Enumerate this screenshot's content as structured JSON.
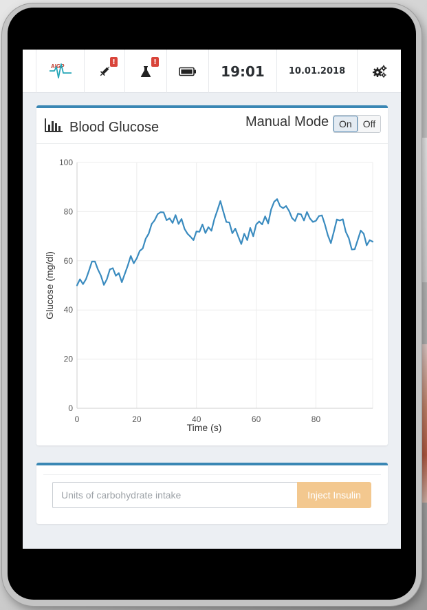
{
  "header": {
    "logo_text": "AIGP",
    "syringe_alert": "!",
    "lab_alert": "!",
    "time": "19:01",
    "date": "10.01.2018",
    "icons": [
      "aigp-logo-icon",
      "syringe-icon",
      "flask-icon",
      "battery-icon",
      "gears-icon"
    ],
    "alert_color": "#d9443a"
  },
  "chart_panel": {
    "title": "Blood Glucose",
    "mode_label": "Manual Mode",
    "toggle_on": "On",
    "toggle_off": "Off",
    "toggle_selected": "On",
    "accent_color": "#3a87b4"
  },
  "chart_data": {
    "type": "line",
    "title": "",
    "xlabel": "Time (s)",
    "ylabel": "Glucose (mg/dl)",
    "xlim": [
      0,
      99
    ],
    "ylim": [
      0,
      100
    ],
    "xticks": [
      "0",
      "20",
      "40",
      "60",
      "80"
    ],
    "yticks": [
      "0",
      "20",
      "40",
      "60",
      "80",
      "100"
    ],
    "grid": true,
    "line_color": "#3a8bbf",
    "series": [
      {
        "name": "",
        "x": [
          0,
          1,
          2,
          3,
          4,
          5,
          6,
          7,
          8,
          9,
          10,
          11,
          12,
          13,
          14,
          15,
          16,
          17,
          18,
          19,
          20,
          21,
          22,
          23,
          24,
          25,
          26,
          27,
          28,
          29,
          30,
          31,
          32,
          33,
          34,
          35,
          36,
          37,
          38,
          39,
          40,
          41,
          42,
          43,
          44,
          45,
          46,
          47,
          48,
          49,
          50,
          51,
          52,
          53,
          54,
          55,
          56,
          57,
          58,
          59,
          60,
          61,
          62,
          63,
          64,
          65,
          66,
          67,
          68,
          69,
          70,
          71,
          72,
          73,
          74,
          75,
          76,
          77,
          78,
          79,
          80,
          81,
          82,
          83,
          84,
          85,
          86,
          87,
          88,
          89,
          90,
          91,
          92,
          93,
          94,
          95,
          96,
          97,
          98,
          99
        ],
        "y": [
          50,
          52.5,
          50.5,
          52.5,
          56,
          59.7,
          59.7,
          56.5,
          54,
          50.2,
          52.5,
          56.5,
          57,
          53.9,
          55,
          51.3,
          54.7,
          58,
          62,
          59,
          61,
          64,
          65,
          69,
          71,
          75,
          76.5,
          79,
          79.8,
          79.7,
          76.5,
          77.3,
          75.4,
          78.6,
          75,
          77,
          73,
          71,
          69.8,
          68.4,
          72,
          71.8,
          74.8,
          71.3,
          73.7,
          72.2,
          77,
          80.5,
          84.3,
          80,
          75.8,
          75.6,
          71.2,
          73.1,
          69.9,
          66.8,
          71,
          68.4,
          73.4,
          70,
          74.8,
          76,
          74.8,
          78.1,
          75.2,
          80.9,
          84,
          85.1,
          82.2,
          81.4,
          82.3,
          80.3,
          77.4,
          76.2,
          79.2,
          78.9,
          76.4,
          79.9,
          77.2,
          75.8,
          76.3,
          78.2,
          78.5,
          74.8,
          70.4,
          67.2,
          71.8,
          76.8,
          76.4,
          76.9,
          71.8,
          69.2,
          64.6,
          64.7,
          68.5,
          72.3,
          71,
          66.3,
          68.4,
          67.8
        ]
      }
    ]
  },
  "insulin_panel": {
    "input_placeholder": "Units of carbohydrate intake",
    "input_value": "",
    "button_label": "Inject Insulin",
    "button_color": "#f3c88f"
  }
}
